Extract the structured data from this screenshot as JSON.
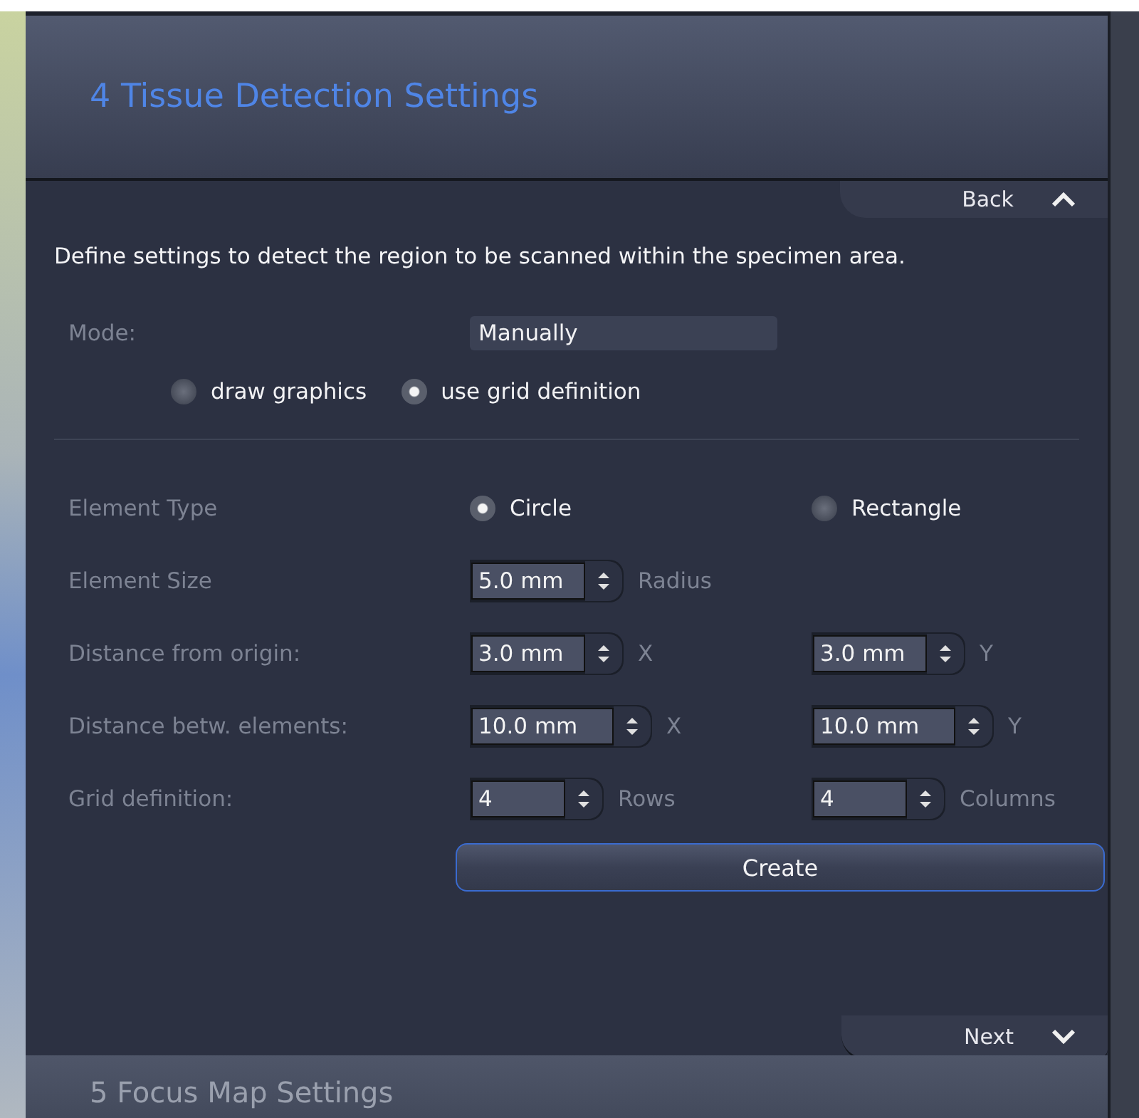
{
  "section": {
    "number": "4",
    "title": "Tissue Detection Settings",
    "back": "Back",
    "description": "Define settings to detect the region to be scanned within the specimen area."
  },
  "mode": {
    "label": "Mode:",
    "value": "Manually",
    "options": [
      {
        "label": "draw graphics",
        "selected": false
      },
      {
        "label": "use grid definition",
        "selected": true
      }
    ]
  },
  "element_type": {
    "label": "Element Type",
    "options": [
      {
        "label": "Circle",
        "selected": true
      },
      {
        "label": "Rectangle",
        "selected": false
      }
    ]
  },
  "rows": [
    {
      "label": "Element Size",
      "spinners": [
        {
          "value": "5.0 mm",
          "unit": "Radius"
        }
      ]
    },
    {
      "label": "Distance from origin:",
      "spinners": [
        {
          "value": "3.0 mm",
          "unit": "X"
        },
        {
          "value": "3.0 mm",
          "unit": "Y"
        }
      ]
    },
    {
      "label": "Distance betw. elements:",
      "spinners": [
        {
          "value": "10.0 mm",
          "unit": "X"
        },
        {
          "value": "10.0 mm",
          "unit": "Y"
        }
      ]
    },
    {
      "label": "Grid definition:",
      "spinners": [
        {
          "value": "4",
          "unit": "Rows"
        },
        {
          "value": "4",
          "unit": "Columns"
        }
      ]
    }
  ],
  "create_button": "Create",
  "next": "Next",
  "next_section": {
    "number": "5",
    "title": "Focus Map Settings"
  }
}
